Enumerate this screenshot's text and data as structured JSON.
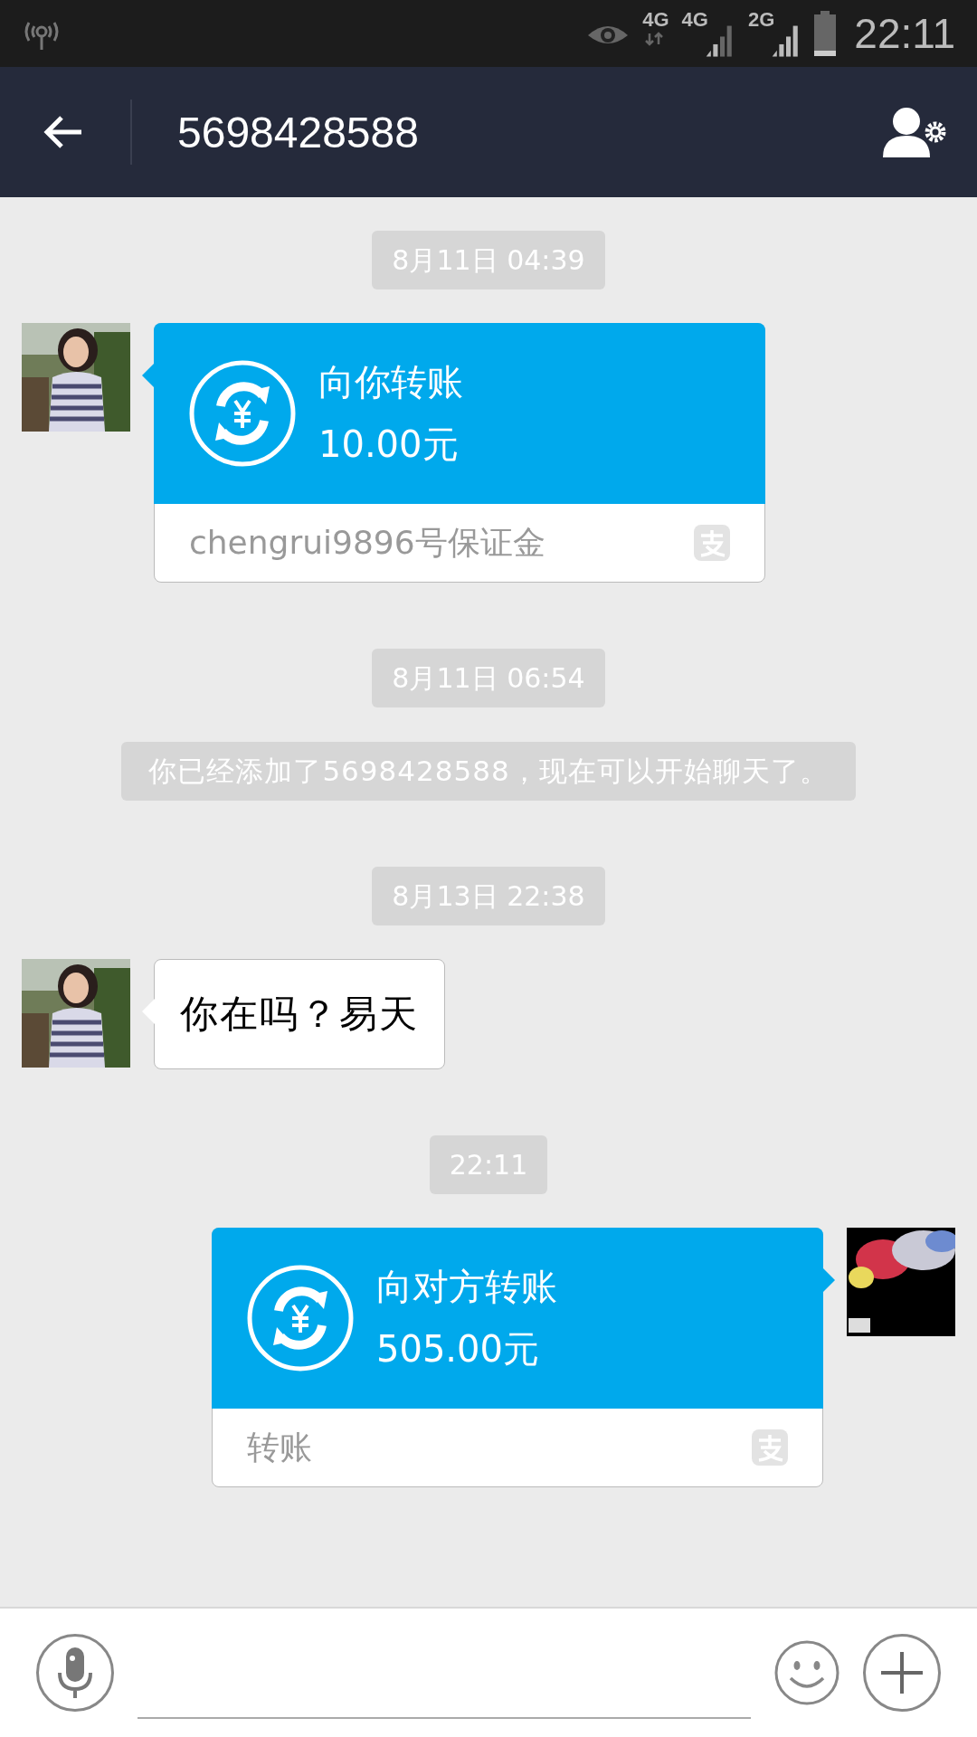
{
  "status_bar": {
    "network_labels": [
      "4G",
      "4G",
      "2G"
    ],
    "time": "22:11"
  },
  "header": {
    "title": "5698428588"
  },
  "messages": [
    {
      "kind": "timestamp",
      "text": "8月11日 04:39"
    },
    {
      "kind": "transfer",
      "outgoing": false,
      "title": "向你转账",
      "amount": "10.00元",
      "note": "chengrui9896号保证金"
    },
    {
      "kind": "timestamp",
      "text": "8月11日 06:54"
    },
    {
      "kind": "system",
      "text": "你已经添加了5698428588，现在可以开始聊天了。"
    },
    {
      "kind": "timestamp",
      "text": "8月13日 22:38"
    },
    {
      "kind": "text",
      "outgoing": false,
      "text": "你在吗？易天"
    },
    {
      "kind": "timestamp",
      "text": "22:11"
    },
    {
      "kind": "transfer",
      "outgoing": true,
      "title": "向对方转账",
      "amount": "505.00元",
      "note": "转账"
    }
  ]
}
